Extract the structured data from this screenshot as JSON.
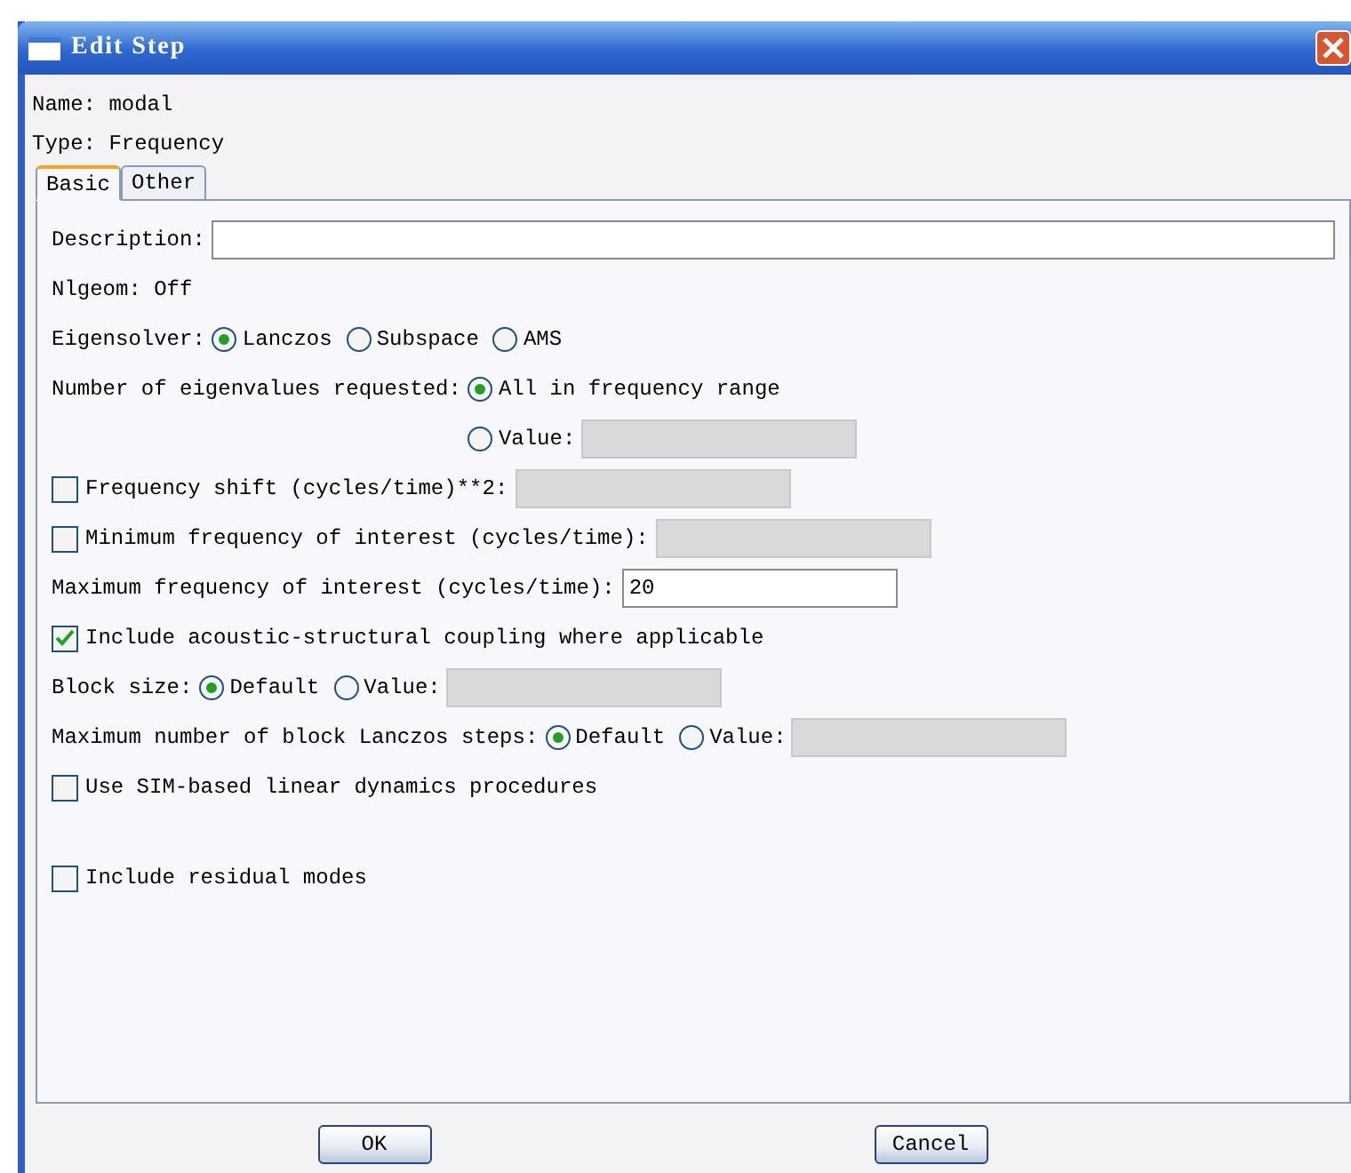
{
  "window": {
    "title": "Edit Step"
  },
  "info": [
    "Name: modal",
    "Type: Frequency"
  ],
  "tabs": [
    {
      "label": "Basic",
      "selected": true
    },
    {
      "label": "Other",
      "selected": false
    }
  ],
  "sections": [
    [
      {
        "kind": "field",
        "label": "Description:",
        "field": {
          "disabled": false,
          "wide": true
        }
      },
      {
        "kind": "text",
        "label": "Nlgeom: Off"
      },
      {
        "kind": "radios",
        "label": "Eigensolver:",
        "options": [
          {
            "label": "Lanczos",
            "selected": true
          },
          {
            "label": "Subspace",
            "selected": false
          },
          {
            "label": "AMS",
            "selected": false
          }
        ]
      },
      {
        "kind": "radio_column",
        "label": "Number of eigenvalues requested:",
        "options": [
          {
            "label": "All in frequency range",
            "selected": true
          },
          {
            "label": "Value:",
            "selected": false,
            "field": {
              "disabled": true
            }
          }
        ]
      },
      {
        "kind": "check",
        "label": "Frequency shift (cycles/time)**2:",
        "checked": false,
        "field": {
          "disabled": true
        }
      },
      {
        "kind": "check",
        "label": "Minimum frequency of interest (cycles/time):",
        "checked": false,
        "field": {
          "disabled": true
        }
      },
      {
        "kind": "field",
        "label": "Maximum frequency of interest (cycles/time):",
        "field": {
          "disabled": false,
          "value": "20"
        }
      },
      {
        "kind": "check",
        "label": "Include acoustic-structural coupling where applicable",
        "checked": true
      },
      {
        "kind": "radios",
        "label": "Block size:",
        "options": [
          {
            "label": "Default",
            "selected": true
          },
          {
            "label": "Value:",
            "selected": false,
            "field": {
              "disabled": true
            }
          }
        ]
      },
      {
        "kind": "radios",
        "label": "Maximum number of block Lanczos steps:",
        "options": [
          {
            "label": "Default",
            "selected": true
          },
          {
            "label": "Value:",
            "selected": false,
            "field": {
              "disabled": true
            }
          }
        ]
      },
      {
        "kind": "check",
        "label": "Use SIM-based linear dynamics procedures",
        "checked": false
      }
    ],
    [
      {
        "kind": "check",
        "label": "Include residual modes",
        "checked": false
      }
    ]
  ],
  "buttons": [
    "OK",
    "Cancel"
  ]
}
